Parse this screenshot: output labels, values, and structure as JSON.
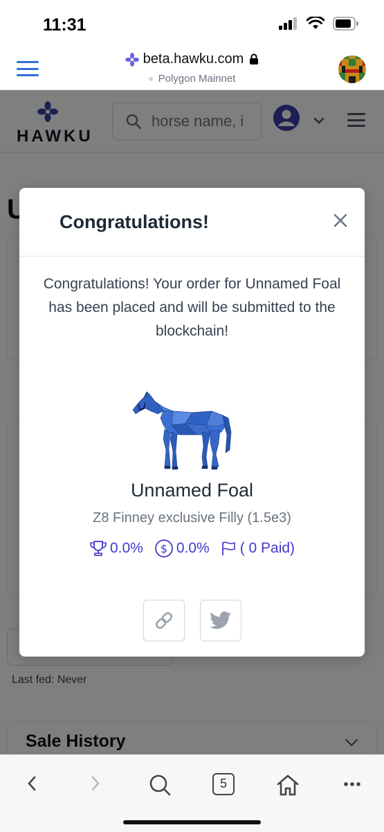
{
  "status_bar": {
    "time": "11:31"
  },
  "browser": {
    "host": "beta.hawku.com",
    "network": "Polygon Mainnet"
  },
  "site": {
    "logo_text": "HAWKU",
    "search_placeholder": "horse name, i",
    "page_title_partial": "U",
    "last_fed": "Last fed: Never",
    "sale_history": "Sale History"
  },
  "modal": {
    "title": "Congratulations!",
    "message": "Congratulations! Your order for Unnamed Foal has been placed and will be submitted to the blockchain!",
    "horse_name": "Unnamed Foal",
    "horse_desc": "Z8 Finney exclusive Filly (1.5e3)",
    "win_rate": "0.0%",
    "earnings_rate": "0.0%",
    "races_paid": "( 0 Paid)"
  },
  "toolbar": {
    "tab_count": "5"
  },
  "colors": {
    "accent": "#4338ca",
    "browser_blue": "#2f6fd6",
    "overlay": "rgba(0,0,0,0.5)",
    "horse_blue": "#3b6fd1"
  },
  "icons": [
    "signal-icon",
    "wifi-icon",
    "battery-icon",
    "hamburger-icon",
    "flower-icon",
    "lock-icon",
    "search-icon",
    "user-icon",
    "chevron-down-icon",
    "close-icon",
    "trophy-icon",
    "dollar-icon",
    "flag-icon",
    "link-icon",
    "twitter-icon",
    "back-icon",
    "forward-icon",
    "home-icon",
    "more-icon"
  ]
}
